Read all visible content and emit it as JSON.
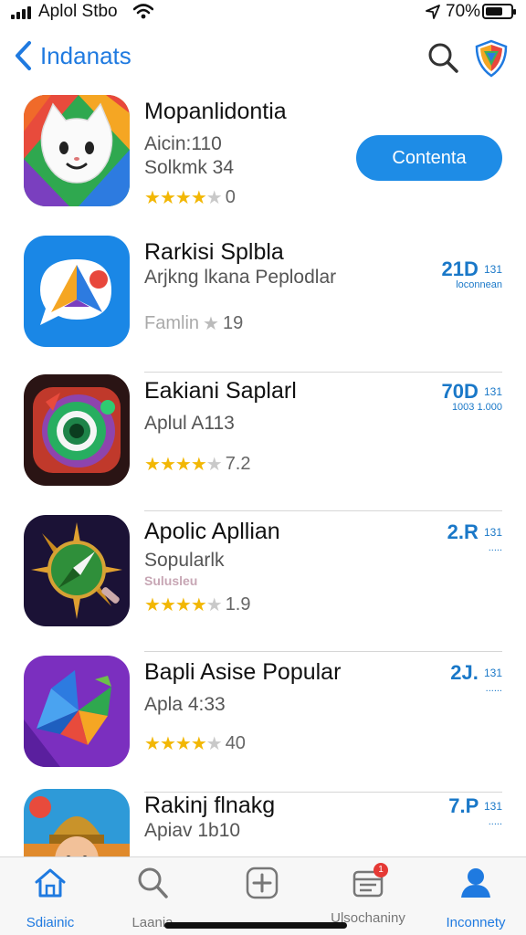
{
  "status_bar": {
    "carrier": "Aplol Stbo",
    "battery_percent": "70%",
    "battery_level": 0.7
  },
  "nav": {
    "back_label": "Indanats"
  },
  "apps": [
    {
      "name": "Mopanlidontia",
      "line1": "Aicin:110",
      "line2": "Solkmk 34",
      "rating_value": 3.5,
      "rating_text": "0",
      "button": "Contenta"
    },
    {
      "name": "Rarkisi Splbla",
      "line1": "Arjkng lkana Peplodlar",
      "rating_prefix": "Famlin",
      "rating_text": "19",
      "metric_big": "21D",
      "metric_sup": "131",
      "metric_small": "loconnean"
    },
    {
      "name": "Eakiani Saplarl",
      "line1": "Aplul A113",
      "rating_value": 3.5,
      "rating_text": "7.2",
      "metric_big": "70D",
      "metric_sup": "131",
      "metric_small": "1003 1.000"
    },
    {
      "name": "Apolic Apllian",
      "line1": "Sopularlk",
      "line2": "Sulusleu",
      "rating_value": 4,
      "rating_text": "1.9",
      "metric_big": "2.R",
      "metric_sup": "131",
      "metric_small": "....."
    },
    {
      "name": "Bapli Asise Popular",
      "line1": "Apla 4:33",
      "rating_value": 3.5,
      "rating_text": "40",
      "metric_big": "2J.",
      "metric_sup": "131",
      "metric_small": "......"
    },
    {
      "name": "Rakinj flnakg",
      "line1": "Apiav 1b10",
      "metric_big": "7.P",
      "metric_sup": "131",
      "metric_small": "....."
    }
  ],
  "tabs": [
    {
      "label": "Sdiainic"
    },
    {
      "label": "Laania"
    },
    {
      "label": ""
    },
    {
      "label": "Ulsochaniny",
      "badge": "1"
    },
    {
      "label": "Inconnety"
    }
  ],
  "colors": {
    "accent": "#1f7ae0",
    "button": "#1e8ce6",
    "star": "#f2b705",
    "badge": "#e53935"
  }
}
